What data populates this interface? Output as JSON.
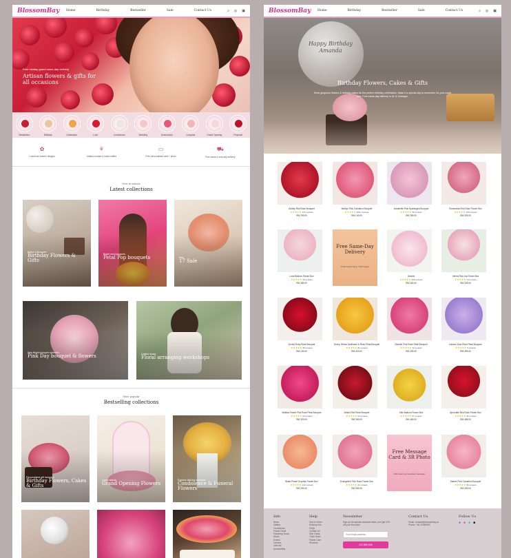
{
  "brand": "BlossomBay",
  "nav": [
    "Home",
    "Birthday",
    "Bestseller",
    "Sale",
    "Contact Us"
  ],
  "icons": {
    "search": "search-icon",
    "account": "user-icon",
    "cart": "cart-icon"
  },
  "left": {
    "hero": {
      "eyebrow": "Free midday grand same-day delivery",
      "title": "Artisan flowers & gifts for all occasions"
    },
    "categories": [
      "Bestsellers",
      "Birthday",
      "Graduation",
      "Love",
      "Condolence",
      "Wedding",
      "Anniversary",
      "Congrats",
      "Grand Opening",
      "Proposal"
    ],
    "perks": [
      "Luxurious modern designs",
      "Artisan-curated & hand-crafted",
      "Free personalised card + photo",
      "Free same & next-day delivery"
    ],
    "latest": {
      "sub": "New in season",
      "title": "Latest collections",
      "cards": [
        {
          "sub": "Ballon & Bouquet",
          "title": "Birthday Flowers & Gifts"
        },
        {
          "sub": "Bright new bouquets",
          "title": "Petal Pop bouquets"
        },
        {
          "sub": "Sale",
          "title": "17 Sale"
        },
        {
          "sub": "New Bright bouquet collection",
          "title": "Pink Day bouquet & flowers"
        },
        {
          "sub": "Limited space",
          "title": "Floral arranging workshops"
        }
      ]
    },
    "bestselling": {
      "sub": "Most popular",
      "title": "Bestselling collections",
      "cards": [
        {
          "sub": "Personalised gift hampers",
          "title": "Birthday Flowers, Cakes & Gifts"
        },
        {
          "sub": "Grand stands",
          "title": "Grand Opening Flowers"
        },
        {
          "sub": "Express delivery available",
          "title": "Condolence & Funeral Flowers"
        },
        {
          "sub": "",
          "title": ""
        },
        {
          "sub": "",
          "title": ""
        },
        {
          "sub": "",
          "title": ""
        }
      ]
    }
  },
  "right": {
    "hero": {
      "balloon": "Happy Birthday Amanda",
      "title": "Birthday Flowers, Cakes & Gifts",
      "desc": "Send gorgeous flowers & birthday cakes for the perfect birthday celebration. Make it a special day to remember for your loved one. Free same-day delivery in KL & Selangor."
    },
    "products": [
      {
        "name": "Ashley Red Rose Bouquet",
        "stars": "★★★★★",
        "reviews": "121 reviews",
        "price": "RM 299.00"
      },
      {
        "name": "Marilyn Pink Carnation Bouquet",
        "stars": "★★★★★",
        "reviews": "300+ reviews",
        "price": "RM 149.00"
      },
      {
        "name": "Annabelle Pink Hydrangea Bouquet",
        "stars": "★★★★★",
        "reviews": "50 reviews",
        "price": "RM 289.00"
      },
      {
        "name": "Esmeralda Pink Rose Flower Box",
        "stars": "★★★★★",
        "reviews": "106 reviews",
        "price": "RM 329.00"
      },
      {
        "name": "Luna Balloon Flower Box",
        "stars": "★★★★★",
        "reviews": "33 reviews",
        "price": "RM 389.00"
      },
      {
        "name": "",
        "stars": "",
        "reviews": "",
        "price": ""
      },
      {
        "name": "Jeanne",
        "stars": "★★★★★",
        "reviews": "200 reviews",
        "price": "RM 269.00"
      },
      {
        "name": "Velma Pink Lily Flower Box",
        "stars": "★★★★★",
        "reviews": "74 reviews",
        "price": "RM 349.00"
      },
      {
        "name": "Orchid Ruby Rose Bouquet",
        "stars": "★★★★★",
        "reviews": "45 reviews",
        "price": "RM 199.00"
      },
      {
        "name": "Sunny Yellow Sunflower & Rose Petal Bouquet",
        "stars": "★★★★★",
        "reviews": "81 reviews",
        "price": "RM 419.00"
      },
      {
        "name": "Dianthe Pink Rose Petal Bouquet",
        "stars": "★★★★★",
        "reviews": "72 reviews",
        "price": "RM 299.00"
      },
      {
        "name": "Iverson Lilac Rose Petal Bouquet",
        "stars": "★★★★★",
        "reviews": "5 reviews",
        "price": "RM 499.00"
      },
      {
        "name": "Matilda Flower Pink Rose Petal Bouquet",
        "stars": "★★★★★",
        "reviews": "63 reviews",
        "price": "RM 329.00"
      },
      {
        "name": "Amani Red Rose Bouquet",
        "stars": "★★★★★",
        "reviews": "94 reviews",
        "price": "RM 399.00"
      },
      {
        "name": "Ollie Balloon Flower Box",
        "stars": "★★★★★",
        "reviews": "57 reviews",
        "price": "RM 469.00"
      },
      {
        "name": "Aphrodite Red Rose Flower Box",
        "stars": "★★★★★",
        "reviews": "41 reviews",
        "price": "RM 489.00"
      },
      {
        "name": "Blake Peach Surprise Flower Box",
        "stars": "★★★★★",
        "reviews": "122 reviews",
        "price": "RM 299.00"
      },
      {
        "name": "Evangeline Pink Rose Flower Box",
        "stars": "★★★★★",
        "reviews": "21 reviews",
        "price": "RM 359.00"
      },
      {
        "name": "",
        "stars": "",
        "reviews": "",
        "price": ""
      },
      {
        "name": "Sabine Pink Carnation Bouquet",
        "stars": "★★★★★",
        "reviews": "56 reviews",
        "price": "RM 269.00"
      }
    ],
    "promo1": {
      "title": "Free Same-Day Delivery",
      "sub": "Order before 3pm. T&Cs apply."
    },
    "promo2": {
      "title": "Free Message Card & 3R Photo",
      "sub": "With every personalised message"
    },
    "footer": {
      "info": {
        "title": "Info",
        "items": [
          "News",
          "Gallery",
          "Condolence",
          "Flower Facts",
          "Flowering Hours",
          "About",
          "Events",
          "Careers",
          "Jobs list",
          "Accessibility"
        ]
      },
      "help": {
        "title": "Help",
        "items": [
          "How to Order",
          "Delivery Info",
          "FAQs",
          "Contact Us",
          "Size Guide",
          "Track Order",
          "Flower Care",
          "Rewards"
        ]
      },
      "newsletter": {
        "title": "Newsletter",
        "desc": "Sign up for special exclusive deals, and get 10% off your first order",
        "placeholder": "Your email address",
        "button": "GO $80,000"
      },
      "contact": {
        "title": "Contact Us",
        "email": "Email: contact@blossombay.co",
        "phone": "Phone: +60 12982963"
      },
      "follow": {
        "title": "Follow Us"
      }
    }
  }
}
